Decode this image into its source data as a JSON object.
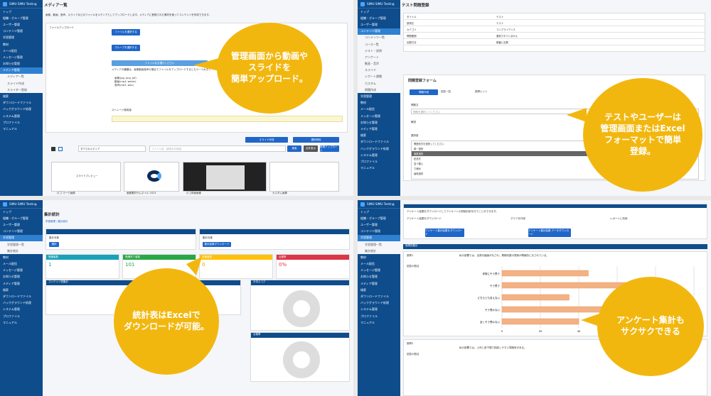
{
  "app": {
    "brand": "SIMU SIMU Testing"
  },
  "sidebar_main": [
    "トップ",
    "組織・グループ管理",
    "ユーザー管理",
    "コンテンツ管理",
    "学習管理",
    "教材",
    "メール配信",
    "メッセージ管理",
    "お知らせ管理",
    "メディア管理",
    "検索",
    "ダウンロードファイル",
    "バックグラウンド処理",
    "システム管理",
    "プロファイル",
    "マニュアル"
  ],
  "q1": {
    "title": "メディア一覧",
    "intro": "画像、動画、音声、スライドなどのファイルをメディアとしてアップロードします。メディアに登録された素材を使ってコンテンツを作成できます。",
    "sub": [
      "メディア一覧",
      "スライド作成",
      "スライダー登録"
    ],
    "upload_label": "ファイルアップロード",
    "file_select": "ファイルを選択する",
    "group_select": "グループを選択する",
    "upload_btn": "ファイルをお選びください",
    "upload_note": "メディアの種類は、画像動画音声の場合でファイルをアップロードするともう一つ大きく",
    "bullets": [
      "画像(jpg, png, gif)",
      "動画(mp4, webm)",
      "音声(mp3, wav)"
    ],
    "storage": "ストレージ使用量",
    "slide_btn": "スライド作成",
    "list_btn": "選択削除",
    "filter": "すべてのメディア",
    "search_ph": "ファイル名、説明文を検索",
    "search_btn": "検索",
    "clear_btn": "全件表示",
    "new_btn": "新規アップロード",
    "thumbs": [
      "スライドプレビュー",
      "画像素材サムネイル 2023",
      "ロゴ マーク画像",
      "ロゴ背景画像",
      "カスタム画像"
    ]
  },
  "q2": {
    "title": "テスト問題登録",
    "rows": [
      [
        "タイトル",
        "テスト"
      ],
      [
        "説明文",
        "テスト"
      ],
      [
        "カテゴリ",
        "コンプライアンス"
      ],
      [
        "問題範囲",
        "選択されていません"
      ],
      [
        "出題方法",
        "順番に出題"
      ]
    ],
    "form_title": "問題登録フォーム",
    "tabs": [
      "問題作成",
      "回答一覧",
      "設問ヒント"
    ],
    "fields": [
      "問題文",
      "解説",
      "選択肢"
    ],
    "select_ph": "問題を選択してください",
    "options": [
      "問題形式を選択してください",
      "単一選択",
      "複数選択",
      "記述式",
      "並べ替え",
      "穴埋め",
      "画像選択"
    ],
    "sub": [
      "コンテンツ一覧",
      "コース一覧",
      "テスト・設問",
      "アンケート",
      "動画・音声",
      "スライド",
      "レポート課題",
      "カスタム",
      "問題作成"
    ]
  },
  "q3": {
    "title": "集計統計",
    "breadcrumb": "学習管理 / 集計統計",
    "cards": [
      {
        "label": "集計対象",
        "btn": "選択"
      },
      {
        "label": "集計対象",
        "btn": "集計結果ダウンロード"
      }
    ],
    "stats": [
      {
        "label": "受講者数",
        "value": "1",
        "color": "#17a2b8"
      },
      {
        "label": "受講完了者数",
        "value": "101",
        "color": "#28a745"
      },
      {
        "label": "合格者数",
        "value": "0",
        "color": "#ffc107"
      },
      {
        "label": "合格率",
        "value": "0%",
        "color": "#dc3545"
      }
    ],
    "content_title": "コンテンツ別集計",
    "score_title": "平均スコア",
    "score_title2": "合格率",
    "sub": [
      "学習管理一覧",
      "集計統計"
    ]
  },
  "q4": {
    "banner": "アンケート結果をダウンロードしてアンケートの詳細分析を行うことができます。",
    "steps": [
      "アンケート結果をダウンロード",
      "グラフを作成",
      "レポートに利用"
    ],
    "btn1": "アンケート集計結果をダウンロード",
    "btn2": "アンケート集計結果 データダウンロード",
    "section": "設問別集計",
    "q1_label": "設問1",
    "q1_text": "私の部署では、活発な議論がなされ、業務改善の提案が積極的になされている。",
    "q2_label": "設問2",
    "q2_text": "私の部署では、上司と部下間で相談しやすい雰囲気がある。",
    "col": "回答の割合",
    "categories": [
      "非常にそう思う",
      "そう思う",
      "どちらとも言えない",
      "そう思わない",
      "全くそう思わない"
    ],
    "values": [
      45,
      70,
      35,
      88,
      40
    ],
    "ticks": [
      "0",
      "20",
      "40",
      "60",
      "80",
      "100"
    ]
  },
  "callouts": {
    "c1": "管理画面から動画や\nスライドを\n簡単アップロード。",
    "c2": "テストやユーザーは\n管理画面またはExcel\nフォーマットで簡単\n登録。",
    "c3": "統計表はExcelで\nダウンロードが可能。",
    "c4": "アンケート集計も\nサクサクできる"
  },
  "colors": {
    "sidebar": "#0e4c8c",
    "accent": "#2f80d1",
    "callout": "#f2b70f",
    "bar": "#f4b183"
  }
}
